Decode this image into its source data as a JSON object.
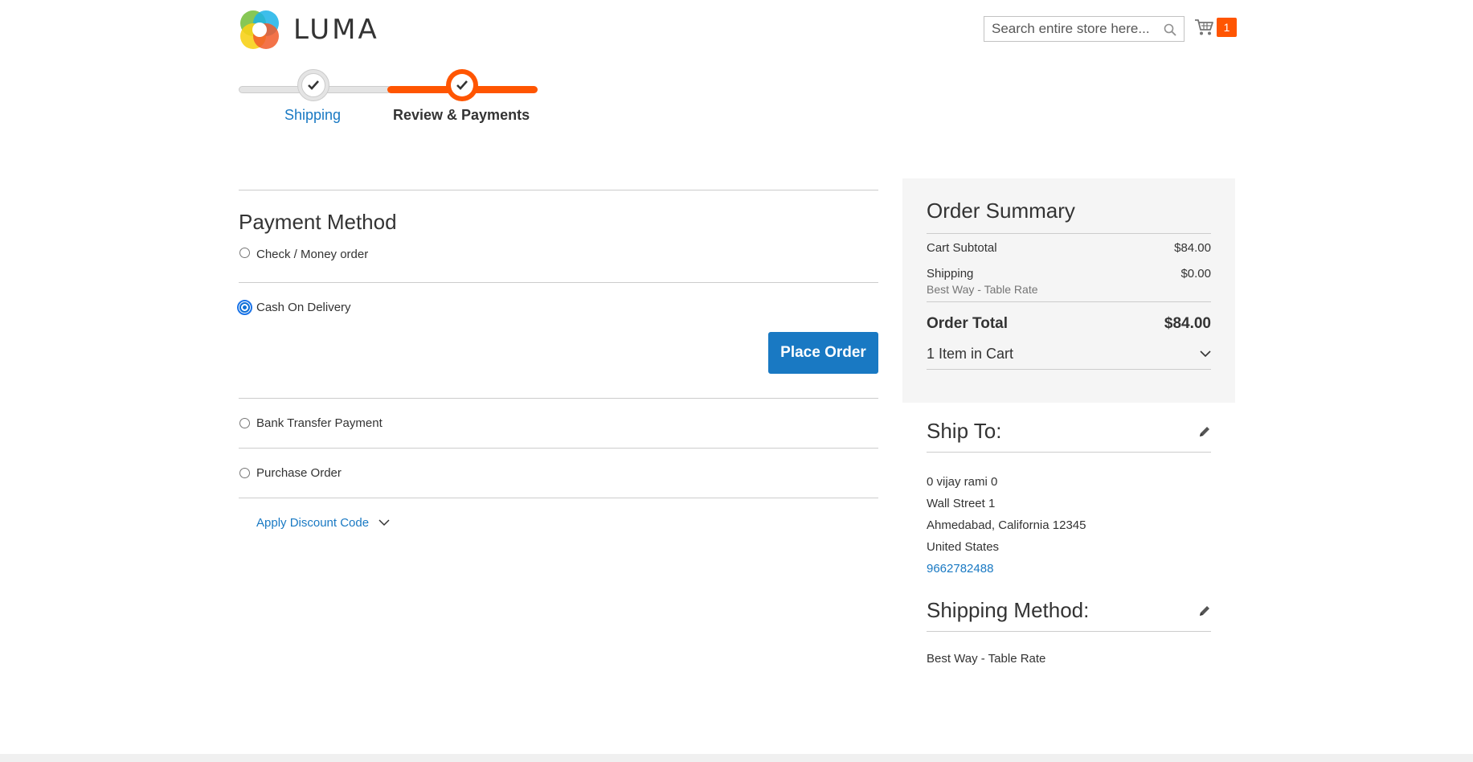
{
  "header": {
    "logo_text": "LUMA",
    "search_placeholder": "Search entire store here...",
    "cart_count": "1"
  },
  "progress": {
    "steps": [
      {
        "label": "Shipping",
        "state": "complete"
      },
      {
        "label": "Review & Payments",
        "state": "active"
      }
    ]
  },
  "payment": {
    "title": "Payment Method",
    "methods": [
      {
        "label": "Check / Money order",
        "selected": false
      },
      {
        "label": "Cash On Delivery",
        "selected": true
      },
      {
        "label": "Bank Transfer Payment",
        "selected": false
      },
      {
        "label": "Purchase Order",
        "selected": false
      }
    ],
    "place_order_label": "Place Order",
    "discount_label": "Apply Discount Code"
  },
  "summary": {
    "title": "Order Summary",
    "subtotal_label": "Cart Subtotal",
    "subtotal_value": "$84.00",
    "shipping_label": "Shipping",
    "shipping_value": "$0.00",
    "shipping_method": "Best Way - Table Rate",
    "total_label": "Order Total",
    "total_value": "$84.00",
    "items_label": "1 Item in Cart"
  },
  "ship_to": {
    "title": "Ship To:",
    "name": "0 vijay rami 0",
    "street": "Wall Street 1",
    "city_line": "Ahmedabad, California 12345",
    "country": "United States",
    "phone": "9662782488"
  },
  "shipping_method": {
    "title": "Shipping Method:",
    "value": "Best Way - Table Rate"
  },
  "colors": {
    "accent_orange": "#ff5501",
    "link_blue": "#1979c3",
    "summary_bg": "#f5f5f5"
  }
}
